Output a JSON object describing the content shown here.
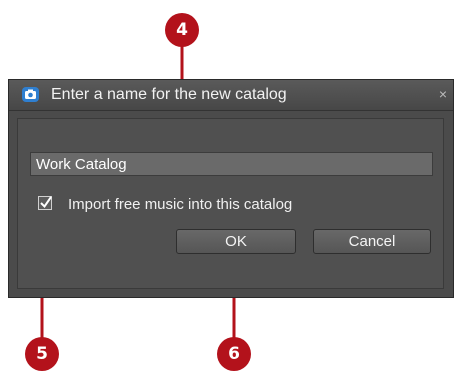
{
  "dialog": {
    "title": "Enter a name for the new catalog",
    "close_glyph": "×",
    "app_icon": "camera-icon",
    "name_field_value": "Work Catalog",
    "checkbox_checked": true,
    "checkbox_label": "Import free music into this catalog",
    "ok_label": "OK",
    "cancel_label": "Cancel"
  },
  "callouts": {
    "name_field": "4",
    "checkbox": "5",
    "ok_button": "6"
  },
  "colors": {
    "callout": "#b3121b",
    "dialog_bg": "#4b4b4b",
    "field_bg": "#6a6a6a"
  }
}
